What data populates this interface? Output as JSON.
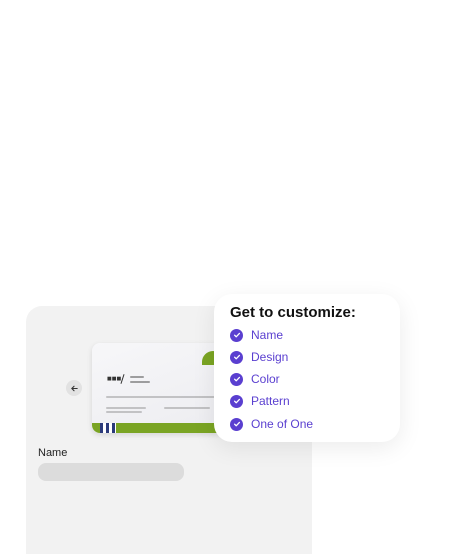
{
  "popover": {
    "title": "Get to customize:",
    "features": [
      "Name",
      "Design",
      "Color",
      "Pattern",
      "One of One"
    ]
  },
  "form": {
    "name_label": "Name",
    "name_value": ""
  },
  "colors": {
    "accent": "#5a3fd0",
    "card_green": "#7aa423",
    "panel_bg": "#f2f2f2"
  }
}
